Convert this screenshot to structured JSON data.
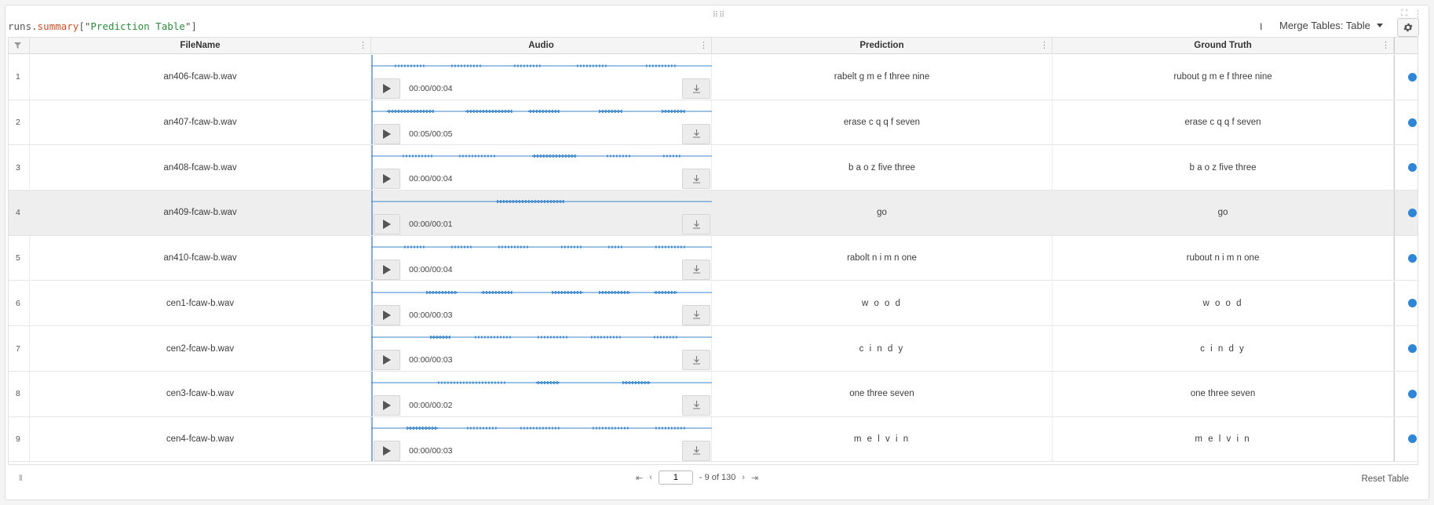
{
  "expression": {
    "prefix": "runs.",
    "key": "summary",
    "open": "[\"",
    "name": "Prediction Table",
    "close": "\"]"
  },
  "toolbar": {
    "merge_label": "Merge Tables: Table",
    "cursor_glyph": "I"
  },
  "header": {
    "filename": "FileName",
    "audio": "Audio",
    "prediction": "Prediction",
    "ground_truth": "Ground Truth"
  },
  "rows": [
    {
      "index": "1",
      "file": "an406-fcaw-b.wav",
      "time": "00:00/00:04",
      "pred": "rabelt g m e f three nine",
      "truth": "rubout g m e f three nine"
    },
    {
      "index": "2",
      "file": "an407-fcaw-b.wav",
      "time": "00:05/00:05",
      "pred": "erase c q q f seven",
      "truth": "erase c q q f seven"
    },
    {
      "index": "3",
      "file": "an408-fcaw-b.wav",
      "time": "00:00/00:04",
      "pred": "b a o z five three",
      "truth": "b a o z five three"
    },
    {
      "index": "4",
      "file": "an409-fcaw-b.wav",
      "time": "00:00/00:01",
      "pred": "go",
      "truth": "go"
    },
    {
      "index": "5",
      "file": "an410-fcaw-b.wav",
      "time": "00:00/00:04",
      "pred": "rabolt n i m n one",
      "truth": "rubout n i m n one"
    },
    {
      "index": "6",
      "file": "cen1-fcaw-b.wav",
      "time": "00:00/00:03",
      "pred": "w o o d",
      "truth": "w o o d"
    },
    {
      "index": "7",
      "file": "cen2-fcaw-b.wav",
      "time": "00:00/00:03",
      "pred": "c i n d y",
      "truth": "c i n d y"
    },
    {
      "index": "8",
      "file": "cen3-fcaw-b.wav",
      "time": "00:00/00:02",
      "pred": "one three seven",
      "truth": "one three seven"
    },
    {
      "index": "9",
      "file": "cen4-fcaw-b.wav",
      "time": "00:00/00:03",
      "pred": "m e l v i n",
      "truth": "m e l v i n"
    }
  ],
  "footer": {
    "page_value": "1",
    "range_text": "- 9 of 130",
    "reset_label": "Reset Table"
  },
  "colors": {
    "accent": "#2f86d6",
    "wave": "#3a86cc"
  },
  "icons": [
    "drag-handle-icon",
    "fullscreen-icon",
    "more-icon",
    "gear-icon",
    "filter-icon",
    "play-icon",
    "download-icon",
    "first-page-icon",
    "prev-page-icon",
    "next-page-icon",
    "last-page-icon",
    "columns-icon"
  ]
}
